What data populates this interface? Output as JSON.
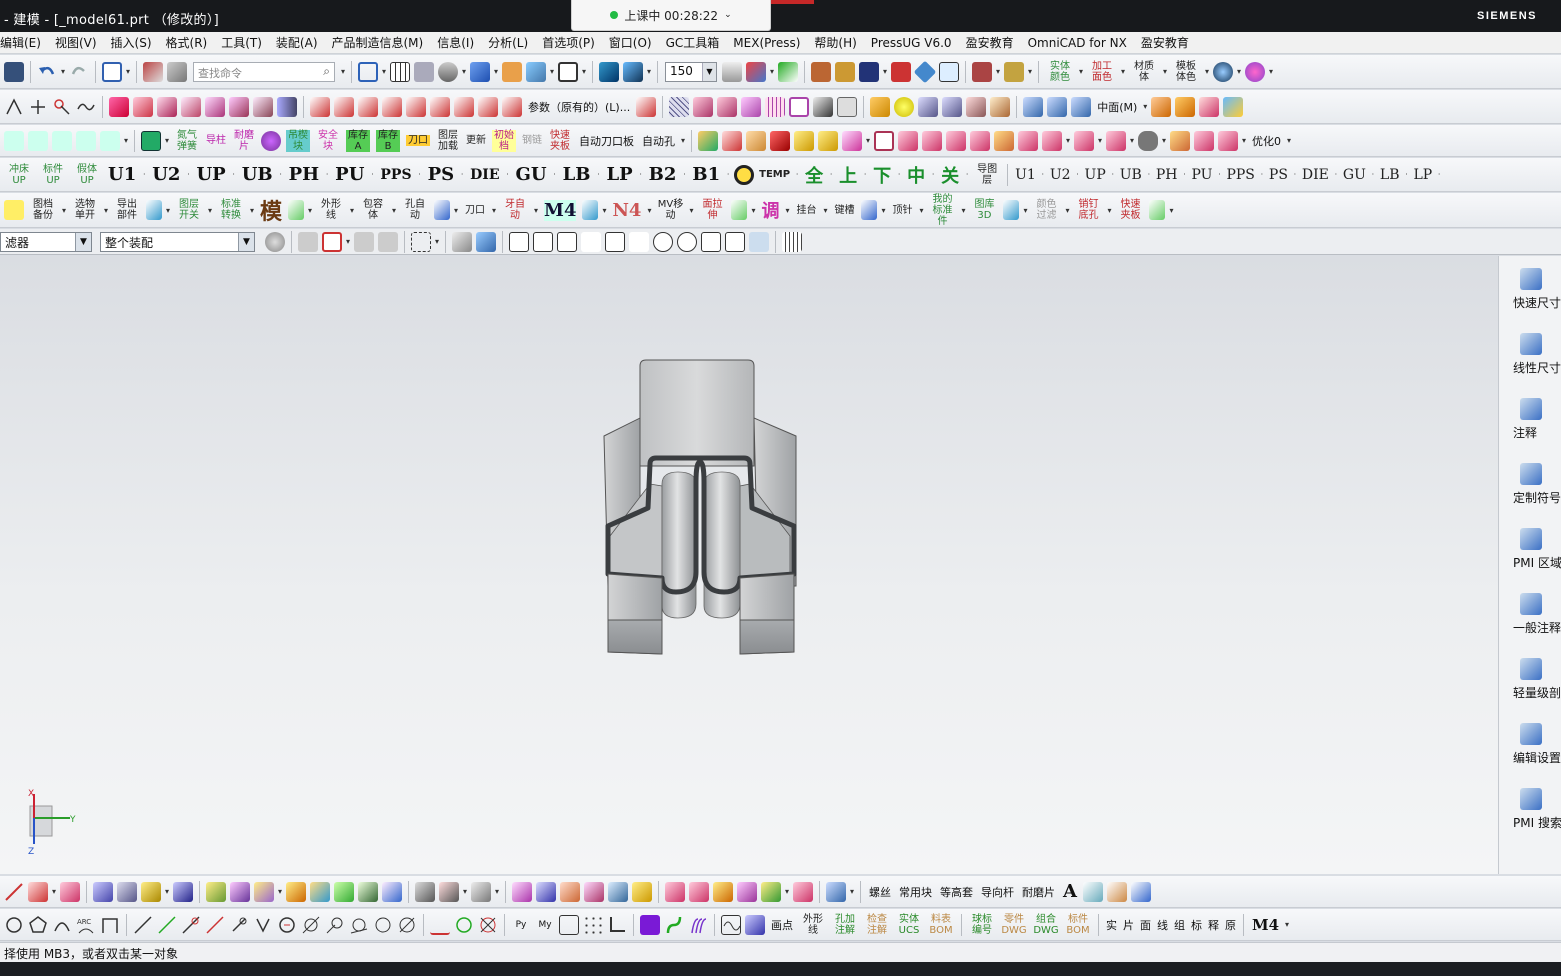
{
  "window": {
    "title": "- 建模 - [_model61.prt （修改的）]",
    "brand": "SIEMENS",
    "live_status": "上课中 00:28:22"
  },
  "menu": [
    "编辑(E)",
    "视图(V)",
    "插入(S)",
    "格式(R)",
    "工具(T)",
    "装配(A)",
    "产品制造信息(M)",
    "信息(I)",
    "分析(L)",
    "首选项(P)",
    "窗口(O)",
    "GC工具箱",
    "MEX(Press)",
    "帮助(H)",
    "PressUG V6.0",
    "盈安教育",
    "OmniCAD for NX",
    "盈安教育"
  ],
  "toolbar1": {
    "search_placeholder": "查找命令",
    "zoom_value": "150",
    "right_labels": [
      "实体颜色",
      "加工面色",
      "材质体",
      "模板体色"
    ]
  },
  "toolbar2": {
    "param_label": "参数（原有的）(L)...",
    "midplane_label": "中面(M)"
  },
  "toolbar3": {
    "labels": [
      "氮气弹簧",
      "导柱",
      "耐磨片",
      "吊楔块",
      "安全块",
      "库存A",
      "库存B",
      "刀口",
      "图层加载",
      "更新",
      "初始档",
      "钢链",
      "快速夹板",
      "自动刀口板",
      "自动孔",
      "优化0"
    ]
  },
  "toolbar4": {
    "labels": [
      "冲床UP",
      "标件UP",
      "假体UP",
      "U1",
      "U2",
      "UP",
      "UB",
      "PH",
      "PU",
      "PPS",
      "PS",
      "DIE",
      "GU",
      "LB",
      "LP",
      "B2",
      "B1",
      "TEMP",
      "全",
      "上",
      "下",
      "中",
      "关",
      "导图层",
      "U1",
      "U2",
      "UP",
      "UB",
      "PH",
      "PU",
      "PPS",
      "PS",
      "DIE",
      "GU",
      "LB",
      "LP"
    ]
  },
  "toolbar5": {
    "labels": [
      "图档备份",
      "选物单开",
      "导出部件",
      "图层开关",
      "标准转换",
      "模",
      "外形线",
      "包容体",
      "孔自动",
      "刀口",
      "牙自动",
      "M4",
      "N4",
      "MV移动",
      "面拉伸",
      "调",
      "挂台",
      "键槽",
      "顶针",
      "我的标准件",
      "图库3D",
      "颜色过滤",
      "销钉底孔",
      "快速夹板"
    ]
  },
  "selection": {
    "filter_value": "滤器",
    "scope_value": "整个装配"
  },
  "resource_bar": [
    {
      "label": "快速尺寸",
      "icon": "quick-dimension-icon"
    },
    {
      "label": "线性尺寸",
      "icon": "linear-dimension-icon"
    },
    {
      "label": "注释",
      "icon": "note-icon"
    },
    {
      "label": "定制符号",
      "icon": "custom-symbol-icon"
    },
    {
      "label": "PMI 区域",
      "icon": "pmi-region-icon"
    },
    {
      "label": "一般注释",
      "icon": "general-note-icon"
    },
    {
      "label": "轻量级剖视",
      "icon": "lightweight-section-icon"
    },
    {
      "label": "编辑设置",
      "icon": "edit-settings-icon"
    },
    {
      "label": "PMI 搜索",
      "icon": "pmi-search-icon"
    }
  ],
  "bottom_toolbar1": {
    "labels": [
      "螺丝",
      "常用块",
      "等高套",
      "导向杆",
      "耐磨片"
    ]
  },
  "bottom_toolbar2": {
    "labels": [
      "画点",
      "外形线",
      "孔加注解",
      "检查注解",
      "实体UCS",
      "料表BOM",
      "球标编号",
      "零件DWG",
      "组合DWG",
      "标件BOM",
      "实",
      "片",
      "面",
      "线",
      "组",
      "标",
      "释",
      "原",
      "M4"
    ]
  },
  "triad": {
    "x_label": "X",
    "y_label": "Y",
    "z_label": "Z"
  },
  "status": "择使用 MB3，或者双击某一对象",
  "colors": {
    "titlebar": "#17191c",
    "viewport_top": "#dadde2",
    "viewport_bottom": "#f4f5f6",
    "part_fill": "#c9cbcd",
    "part_edge": "#3a3d40"
  }
}
